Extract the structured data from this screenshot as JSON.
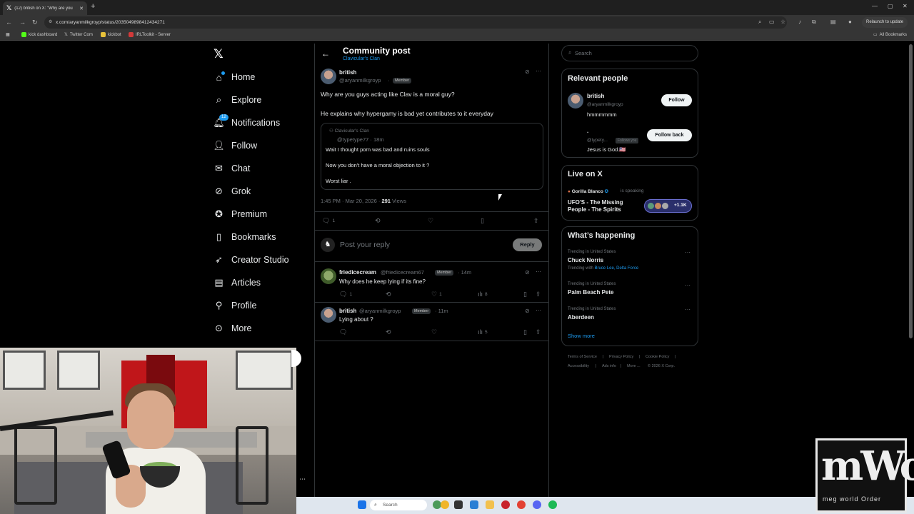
{
  "browser": {
    "tab_title": "(12) british on X: \"Why are you",
    "url": "x.com/aryanmilkgroyp/status/2035049898412434271",
    "relaunch_label": "Relaunch to update",
    "bookmarks": [
      "kick dashboard",
      "Twitter Com",
      "kickbot",
      "IRLToolkit - Server"
    ],
    "all_bookmarks": "All Bookmarks"
  },
  "nav": {
    "notifications_badge": "12",
    "items": [
      "Home",
      "Explore",
      "Notifications",
      "Follow",
      "Chat",
      "Grok",
      "Premium",
      "Bookmarks",
      "Creator Studio",
      "Articles",
      "Profile",
      "More"
    ]
  },
  "header": {
    "title": "Community post",
    "subtitle": "Clavicular's Clan"
  },
  "post": {
    "name": "british",
    "handle": "@aryanmilkgroyp",
    "member": "Member",
    "line1": "Why are you guys acting like Clav is a moral guy?",
    "line2": "He explains why hypergamy is bad yet contributes to it everyday",
    "quote": {
      "community": "Clavicular's Clan",
      "handle": "@typetype77 · 18m",
      "line1": "Wait I thought porn was bad and ruins souls",
      "line2": "Now you don't have a moral objection to it ?",
      "line3": "Worst liar ."
    },
    "time": "1:45 PM · Mar 20, 2026 · ",
    "views_count": "291",
    "views_label": " Views",
    "replies": "1"
  },
  "reply_box": {
    "placeholder": "Post your reply",
    "button": "Reply"
  },
  "replies": [
    {
      "name": "friedicecream",
      "handle": "@friedicecream67",
      "member": "Member",
      "time": "· 14m",
      "text": "Why does he keep lying if its fine?",
      "replies": "1",
      "likes": "1",
      "views": "8"
    },
    {
      "name": "british",
      "handle": "@aryanmilkgroyp",
      "member": "Member",
      "time": "· 11m",
      "text": "Lying about ?",
      "views": "5"
    }
  ],
  "sidebar": {
    "search_placeholder": "Search",
    "relevant": {
      "title": "Relevant people",
      "p1_name": "british",
      "p1_handle": "@aryanmilkgroyp",
      "p1_bio": "hmmmmmm",
      "p1_button": "Follow",
      "p2_name": ".",
      "p2_handle": "@typety...",
      "p2_follows": "Follows you",
      "p2_bio": "Jesus is God.🇺🇸",
      "p2_button": "Follow back"
    },
    "live": {
      "title": "Live on X",
      "host": "Gorilla Blanco",
      "speaking": "is speaking",
      "space_title": "UFO'S - The Missing People - The Spirits",
      "listeners": "+1.1K"
    },
    "happening": {
      "title": "What’s happening",
      "trends": [
        {
          "context": "Trending in United States",
          "name": "Chuck Norris",
          "with_label": "Trending with ",
          "with": "Bruce Lee, Delta Force"
        },
        {
          "context": "Trending in United States",
          "name": "Palm Beach Pete"
        },
        {
          "context": "Trending in United States",
          "name": "Aberdeen"
        }
      ],
      "show_more": "Show more"
    },
    "footer": [
      "Terms of Service",
      "Privacy Policy",
      "Cookie Policy",
      "Accessibility",
      "Ads info",
      "More ...",
      "© 2026 X Corp."
    ]
  },
  "taskbar": {
    "search": "Search"
  },
  "watermark": {
    "big": "mWo",
    "small": "meg world Order"
  },
  "colors": {
    "accent": "#1d9bf0",
    "background": "#000000",
    "border": "#2f3336",
    "muted": "#71767b"
  }
}
